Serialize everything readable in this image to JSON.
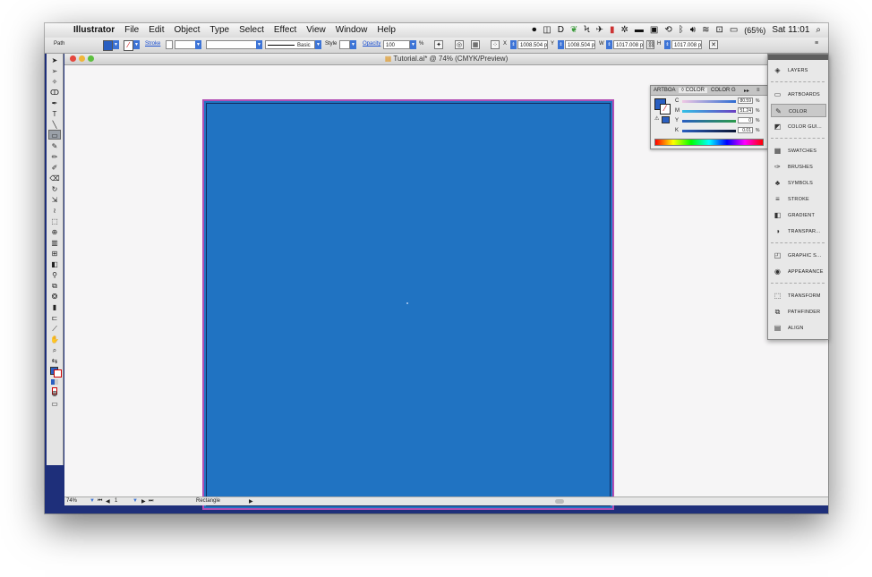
{
  "menubar": {
    "apple": "",
    "app_name": "Illustrator",
    "items": [
      "File",
      "Edit",
      "Object",
      "Type",
      "Select",
      "Effect",
      "View",
      "Window",
      "Help"
    ],
    "battery": "(65%)",
    "clock": "Sat 11:01",
    "search_icon": "⌕"
  },
  "control": {
    "selection_type": "Path",
    "stroke_label": "Stroke",
    "brush_label": "Basic",
    "style_label": "Style",
    "opacity_label": "Opacity",
    "opacity_value": "100",
    "opacity_unit": "%",
    "x_label": "X",
    "x_value": "1008.504 px",
    "y_label": "Y",
    "y_value": "1008.504 px",
    "w_label": "W",
    "w_value": "1017.008 px",
    "h_label": "H",
    "h_value": "1017.008 px",
    "fill_color": "#2a5fc1"
  },
  "document": {
    "title": "Tutorial.ai* @ 74% (CMYK/Preview)",
    "zoom": "74%",
    "artboard_number": "1",
    "status_text": "Rectangle",
    "artboard_color": "#2073c2",
    "artboard_border": "#b24fb4"
  },
  "color_panel": {
    "tabs": [
      "ARTBOA",
      "◊ COLOR",
      "COLOR G"
    ],
    "sliders": [
      {
        "label": "C",
        "value": "80.59",
        "unit": "%"
      },
      {
        "label": "M",
        "value": "51.24",
        "unit": "%"
      },
      {
        "label": "Y",
        "value": "0",
        "unit": "%"
      },
      {
        "label": "K",
        "value": "0.01",
        "unit": "%"
      }
    ]
  },
  "side_panel": {
    "items": [
      {
        "label": "LAYERS",
        "icon": "layers-icon",
        "glyph": "◈"
      },
      {
        "label": "ARTBOARDS",
        "icon": "artboards-icon",
        "glyph": "▭"
      },
      {
        "label": "COLOR",
        "icon": "color-icon",
        "glyph": "✎"
      },
      {
        "label": "COLOR GUI...",
        "icon": "color-guide-icon",
        "glyph": "◩"
      },
      {
        "label": "SWATCHES",
        "icon": "swatches-icon",
        "glyph": "▦"
      },
      {
        "label": "BRUSHES",
        "icon": "brushes-icon",
        "glyph": "✑"
      },
      {
        "label": "SYMBOLS",
        "icon": "symbols-icon",
        "glyph": "♣"
      },
      {
        "label": "STROKE",
        "icon": "stroke-icon",
        "glyph": "≡"
      },
      {
        "label": "GRADIENT",
        "icon": "gradient-icon",
        "glyph": "◧"
      },
      {
        "label": "TRANSPAR...",
        "icon": "transparency-icon",
        "glyph": "◑"
      },
      {
        "label": "GRAPHIC S...",
        "icon": "graphic-styles-icon",
        "glyph": "◰"
      },
      {
        "label": "APPEARANCE",
        "icon": "appearance-icon",
        "glyph": "◉"
      },
      {
        "label": "TRANSFORM",
        "icon": "transform-icon",
        "glyph": "⬚"
      },
      {
        "label": "PATHFINDER",
        "icon": "pathfinder-icon",
        "glyph": "⧉"
      },
      {
        "label": "ALIGN",
        "icon": "align-icon",
        "glyph": "▤"
      }
    ]
  }
}
